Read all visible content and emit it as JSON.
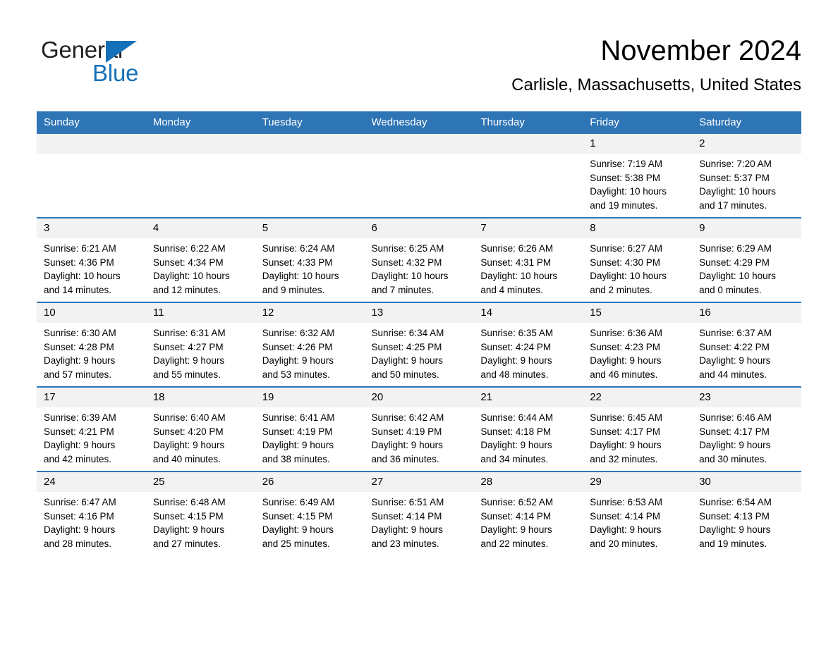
{
  "brand": {
    "name_part1": "General",
    "name_part2": "Blue",
    "triangle_icon": "triangle-logo-icon",
    "color_blue": "#1470b8",
    "color_dark": "#231f20"
  },
  "header": {
    "month_title": "November 2024",
    "location": "Carlisle, Massachusetts, United States"
  },
  "theme": {
    "header_blue": "#2e75b6",
    "daynum_gray": "#f2f2f2",
    "text_black": "#000000"
  },
  "calendar": {
    "weekday_headers": [
      "Sunday",
      "Monday",
      "Tuesday",
      "Wednesday",
      "Thursday",
      "Friday",
      "Saturday"
    ],
    "weeks": [
      [
        {
          "day": "",
          "empty": true,
          "sunrise": "",
          "sunset": "",
          "daylight_line1": "",
          "daylight_line2": ""
        },
        {
          "day": "",
          "empty": true,
          "sunrise": "",
          "sunset": "",
          "daylight_line1": "",
          "daylight_line2": ""
        },
        {
          "day": "",
          "empty": true,
          "sunrise": "",
          "sunset": "",
          "daylight_line1": "",
          "daylight_line2": ""
        },
        {
          "day": "",
          "empty": true,
          "sunrise": "",
          "sunset": "",
          "daylight_line1": "",
          "daylight_line2": ""
        },
        {
          "day": "",
          "empty": true,
          "sunrise": "",
          "sunset": "",
          "daylight_line1": "",
          "daylight_line2": ""
        },
        {
          "day": "1",
          "empty": false,
          "sunrise": "Sunrise: 7:19 AM",
          "sunset": "Sunset: 5:38 PM",
          "daylight_line1": "Daylight: 10 hours",
          "daylight_line2": "and 19 minutes."
        },
        {
          "day": "2",
          "empty": false,
          "sunrise": "Sunrise: 7:20 AM",
          "sunset": "Sunset: 5:37 PM",
          "daylight_line1": "Daylight: 10 hours",
          "daylight_line2": "and 17 minutes."
        }
      ],
      [
        {
          "day": "3",
          "empty": false,
          "sunrise": "Sunrise: 6:21 AM",
          "sunset": "Sunset: 4:36 PM",
          "daylight_line1": "Daylight: 10 hours",
          "daylight_line2": "and 14 minutes."
        },
        {
          "day": "4",
          "empty": false,
          "sunrise": "Sunrise: 6:22 AM",
          "sunset": "Sunset: 4:34 PM",
          "daylight_line1": "Daylight: 10 hours",
          "daylight_line2": "and 12 minutes."
        },
        {
          "day": "5",
          "empty": false,
          "sunrise": "Sunrise: 6:24 AM",
          "sunset": "Sunset: 4:33 PM",
          "daylight_line1": "Daylight: 10 hours",
          "daylight_line2": "and 9 minutes."
        },
        {
          "day": "6",
          "empty": false,
          "sunrise": "Sunrise: 6:25 AM",
          "sunset": "Sunset: 4:32 PM",
          "daylight_line1": "Daylight: 10 hours",
          "daylight_line2": "and 7 minutes."
        },
        {
          "day": "7",
          "empty": false,
          "sunrise": "Sunrise: 6:26 AM",
          "sunset": "Sunset: 4:31 PM",
          "daylight_line1": "Daylight: 10 hours",
          "daylight_line2": "and 4 minutes."
        },
        {
          "day": "8",
          "empty": false,
          "sunrise": "Sunrise: 6:27 AM",
          "sunset": "Sunset: 4:30 PM",
          "daylight_line1": "Daylight: 10 hours",
          "daylight_line2": "and 2 minutes."
        },
        {
          "day": "9",
          "empty": false,
          "sunrise": "Sunrise: 6:29 AM",
          "sunset": "Sunset: 4:29 PM",
          "daylight_line1": "Daylight: 10 hours",
          "daylight_line2": "and 0 minutes."
        }
      ],
      [
        {
          "day": "10",
          "empty": false,
          "sunrise": "Sunrise: 6:30 AM",
          "sunset": "Sunset: 4:28 PM",
          "daylight_line1": "Daylight: 9 hours",
          "daylight_line2": "and 57 minutes."
        },
        {
          "day": "11",
          "empty": false,
          "sunrise": "Sunrise: 6:31 AM",
          "sunset": "Sunset: 4:27 PM",
          "daylight_line1": "Daylight: 9 hours",
          "daylight_line2": "and 55 minutes."
        },
        {
          "day": "12",
          "empty": false,
          "sunrise": "Sunrise: 6:32 AM",
          "sunset": "Sunset: 4:26 PM",
          "daylight_line1": "Daylight: 9 hours",
          "daylight_line2": "and 53 minutes."
        },
        {
          "day": "13",
          "empty": false,
          "sunrise": "Sunrise: 6:34 AM",
          "sunset": "Sunset: 4:25 PM",
          "daylight_line1": "Daylight: 9 hours",
          "daylight_line2": "and 50 minutes."
        },
        {
          "day": "14",
          "empty": false,
          "sunrise": "Sunrise: 6:35 AM",
          "sunset": "Sunset: 4:24 PM",
          "daylight_line1": "Daylight: 9 hours",
          "daylight_line2": "and 48 minutes."
        },
        {
          "day": "15",
          "empty": false,
          "sunrise": "Sunrise: 6:36 AM",
          "sunset": "Sunset: 4:23 PM",
          "daylight_line1": "Daylight: 9 hours",
          "daylight_line2": "and 46 minutes."
        },
        {
          "day": "16",
          "empty": false,
          "sunrise": "Sunrise: 6:37 AM",
          "sunset": "Sunset: 4:22 PM",
          "daylight_line1": "Daylight: 9 hours",
          "daylight_line2": "and 44 minutes."
        }
      ],
      [
        {
          "day": "17",
          "empty": false,
          "sunrise": "Sunrise: 6:39 AM",
          "sunset": "Sunset: 4:21 PM",
          "daylight_line1": "Daylight: 9 hours",
          "daylight_line2": "and 42 minutes."
        },
        {
          "day": "18",
          "empty": false,
          "sunrise": "Sunrise: 6:40 AM",
          "sunset": "Sunset: 4:20 PM",
          "daylight_line1": "Daylight: 9 hours",
          "daylight_line2": "and 40 minutes."
        },
        {
          "day": "19",
          "empty": false,
          "sunrise": "Sunrise: 6:41 AM",
          "sunset": "Sunset: 4:19 PM",
          "daylight_line1": "Daylight: 9 hours",
          "daylight_line2": "and 38 minutes."
        },
        {
          "day": "20",
          "empty": false,
          "sunrise": "Sunrise: 6:42 AM",
          "sunset": "Sunset: 4:19 PM",
          "daylight_line1": "Daylight: 9 hours",
          "daylight_line2": "and 36 minutes."
        },
        {
          "day": "21",
          "empty": false,
          "sunrise": "Sunrise: 6:44 AM",
          "sunset": "Sunset: 4:18 PM",
          "daylight_line1": "Daylight: 9 hours",
          "daylight_line2": "and 34 minutes."
        },
        {
          "day": "22",
          "empty": false,
          "sunrise": "Sunrise: 6:45 AM",
          "sunset": "Sunset: 4:17 PM",
          "daylight_line1": "Daylight: 9 hours",
          "daylight_line2": "and 32 minutes."
        },
        {
          "day": "23",
          "empty": false,
          "sunrise": "Sunrise: 6:46 AM",
          "sunset": "Sunset: 4:17 PM",
          "daylight_line1": "Daylight: 9 hours",
          "daylight_line2": "and 30 minutes."
        }
      ],
      [
        {
          "day": "24",
          "empty": false,
          "sunrise": "Sunrise: 6:47 AM",
          "sunset": "Sunset: 4:16 PM",
          "daylight_line1": "Daylight: 9 hours",
          "daylight_line2": "and 28 minutes."
        },
        {
          "day": "25",
          "empty": false,
          "sunrise": "Sunrise: 6:48 AM",
          "sunset": "Sunset: 4:15 PM",
          "daylight_line1": "Daylight: 9 hours",
          "daylight_line2": "and 27 minutes."
        },
        {
          "day": "26",
          "empty": false,
          "sunrise": "Sunrise: 6:49 AM",
          "sunset": "Sunset: 4:15 PM",
          "daylight_line1": "Daylight: 9 hours",
          "daylight_line2": "and 25 minutes."
        },
        {
          "day": "27",
          "empty": false,
          "sunrise": "Sunrise: 6:51 AM",
          "sunset": "Sunset: 4:14 PM",
          "daylight_line1": "Daylight: 9 hours",
          "daylight_line2": "and 23 minutes."
        },
        {
          "day": "28",
          "empty": false,
          "sunrise": "Sunrise: 6:52 AM",
          "sunset": "Sunset: 4:14 PM",
          "daylight_line1": "Daylight: 9 hours",
          "daylight_line2": "and 22 minutes."
        },
        {
          "day": "29",
          "empty": false,
          "sunrise": "Sunrise: 6:53 AM",
          "sunset": "Sunset: 4:14 PM",
          "daylight_line1": "Daylight: 9 hours",
          "daylight_line2": "and 20 minutes."
        },
        {
          "day": "30",
          "empty": false,
          "sunrise": "Sunrise: 6:54 AM",
          "sunset": "Sunset: 4:13 PM",
          "daylight_line1": "Daylight: 9 hours",
          "daylight_line2": "and 19 minutes."
        }
      ]
    ]
  }
}
